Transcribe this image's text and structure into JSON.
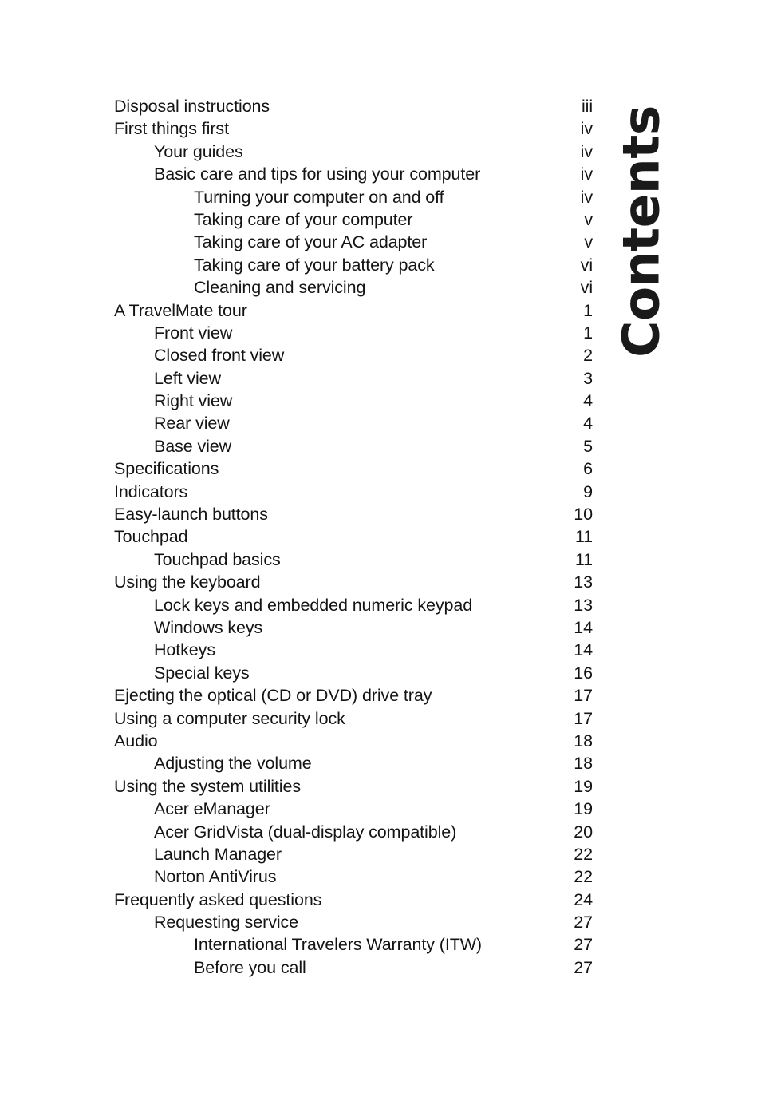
{
  "page": {
    "heading": "Contents",
    "background_color": "#ffffff",
    "text_color": "#141414"
  },
  "toc": {
    "entries": [
      {
        "title": "Disposal instructions",
        "page": "iii",
        "level": 0
      },
      {
        "title": "First things first",
        "page": "iv",
        "level": 0
      },
      {
        "title": "Your guides",
        "page": "iv",
        "level": 1
      },
      {
        "title": "Basic care and tips for using your computer",
        "page": "iv",
        "level": 1
      },
      {
        "title": "Turning your computer on and off",
        "page": "iv",
        "level": 2
      },
      {
        "title": "Taking care of your computer",
        "page": "v",
        "level": 2
      },
      {
        "title": "Taking care of your AC adapter",
        "page": "v",
        "level": 2
      },
      {
        "title": "Taking care of your battery pack",
        "page": "vi",
        "level": 2
      },
      {
        "title": "Cleaning and servicing",
        "page": "vi",
        "level": 2
      },
      {
        "title": "A TravelMate tour",
        "page": "1",
        "level": 0
      },
      {
        "title": "Front view",
        "page": "1",
        "level": 1
      },
      {
        "title": "Closed front view",
        "page": "2",
        "level": 1
      },
      {
        "title": "Left view",
        "page": "3",
        "level": 1
      },
      {
        "title": "Right view",
        "page": "4",
        "level": 1
      },
      {
        "title": "Rear view",
        "page": "4",
        "level": 1
      },
      {
        "title": "Base view",
        "page": "5",
        "level": 1
      },
      {
        "title": "Specifications",
        "page": "6",
        "level": 0
      },
      {
        "title": "Indicators",
        "page": "9",
        "level": 0
      },
      {
        "title": "Easy-launch buttons",
        "page": "10",
        "level": 0
      },
      {
        "title": "Touchpad",
        "page": "11",
        "level": 0
      },
      {
        "title": "Touchpad basics",
        "page": "11",
        "level": 1
      },
      {
        "title": "Using the keyboard",
        "page": "13",
        "level": 0
      },
      {
        "title": "Lock keys and embedded numeric keypad",
        "page": "13",
        "level": 1
      },
      {
        "title": "Windows keys",
        "page": "14",
        "level": 1
      },
      {
        "title": "Hotkeys",
        "page": "14",
        "level": 1
      },
      {
        "title": "Special keys",
        "page": "16",
        "level": 1
      },
      {
        "title": "Ejecting the optical (CD or DVD) drive tray",
        "page": "17",
        "level": 0
      },
      {
        "title": "Using a computer security lock",
        "page": "17",
        "level": 0
      },
      {
        "title": "Audio",
        "page": "18",
        "level": 0
      },
      {
        "title": "Adjusting the volume",
        "page": "18",
        "level": 1
      },
      {
        "title": "Using the system utilities",
        "page": "19",
        "level": 0
      },
      {
        "title": "Acer eManager",
        "page": "19",
        "level": 1
      },
      {
        "title": "Acer GridVista (dual-display compatible)",
        "page": "20",
        "level": 1
      },
      {
        "title": "Launch Manager",
        "page": "22",
        "level": 1
      },
      {
        "title": "Norton AntiVirus",
        "page": "22",
        "level": 1
      },
      {
        "title": "Frequently asked questions",
        "page": "24",
        "level": 0
      },
      {
        "title": "Requesting service",
        "page": "27",
        "level": 1
      },
      {
        "title": "International Travelers Warranty (ITW)",
        "page": "27",
        "level": 2
      },
      {
        "title": "Before you call",
        "page": "27",
        "level": 2
      }
    ]
  }
}
